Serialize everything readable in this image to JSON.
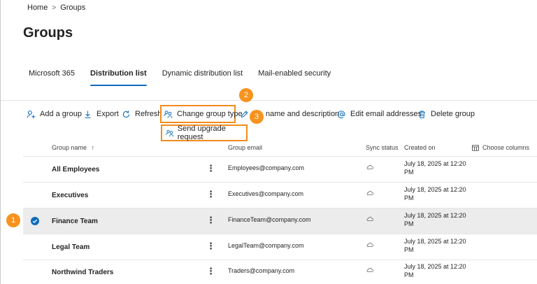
{
  "breadcrumb": {
    "home": "Home",
    "separator": ">",
    "current": "Groups"
  },
  "page": {
    "title": "Groups"
  },
  "tabs": [
    {
      "label": "Microsoft 365",
      "active": false
    },
    {
      "label": "Distribution list",
      "active": true
    },
    {
      "label": "Dynamic distribution list",
      "active": false
    },
    {
      "label": "Mail-enabled security",
      "active": false
    }
  ],
  "toolbar": {
    "add_group": "Add a group",
    "export": "Export",
    "refresh": "Refresh",
    "change_group_type": "Change group type",
    "edit_name": "name and description",
    "edit_email": "Edit email addresses",
    "delete_group": "Delete group"
  },
  "dropdown": {
    "send_upgrade": "Send upgrade request"
  },
  "callouts": [
    "1",
    "2",
    "3"
  ],
  "table": {
    "headers": {
      "group_name": "Group name",
      "sort_indicator": "↑",
      "group_email": "Group email",
      "sync_status": "Sync status",
      "created_on": "Created on",
      "choose_columns": "Choose columns"
    },
    "rows": [
      {
        "name": "All Employees",
        "email": "Employees@company.com",
        "created": "July 18, 2025 at 12:20 PM",
        "selected": false
      },
      {
        "name": "Executives",
        "email": "Executives@company.com",
        "created": "July 18, 2025 at 12:20 PM",
        "selected": false
      },
      {
        "name": "Finance Team",
        "email": "FinanceTeam@company.com",
        "created": "July 18, 2025 at 12:20 PM",
        "selected": true
      },
      {
        "name": "Legal Team",
        "email": "LegalTeam@company.com",
        "created": "July 18, 2025 at 12:20 PM",
        "selected": false
      },
      {
        "name": "Northwind Traders",
        "email": "Traders@company.com",
        "created": "July 18, 2025 at 12:20 PM",
        "selected": false
      }
    ]
  },
  "colors": {
    "accent": "#0f6cbd",
    "callout": "#f7931e",
    "highlight_border": "#f38b1e",
    "selected_row": "#ececec"
  },
  "icons": {
    "add_group": "add-person-icon",
    "export": "download-icon",
    "refresh": "refresh-icon",
    "change_group_type": "people-swap-icon",
    "edit": "pencil-icon",
    "edit_email": "at-sign-icon",
    "delete": "trash-icon",
    "send_upgrade": "people-swap-icon",
    "sync": "cloud-icon",
    "choose_columns": "columns-icon",
    "row_select": "checkmark-circle-icon",
    "more": "more-vertical-icon"
  }
}
